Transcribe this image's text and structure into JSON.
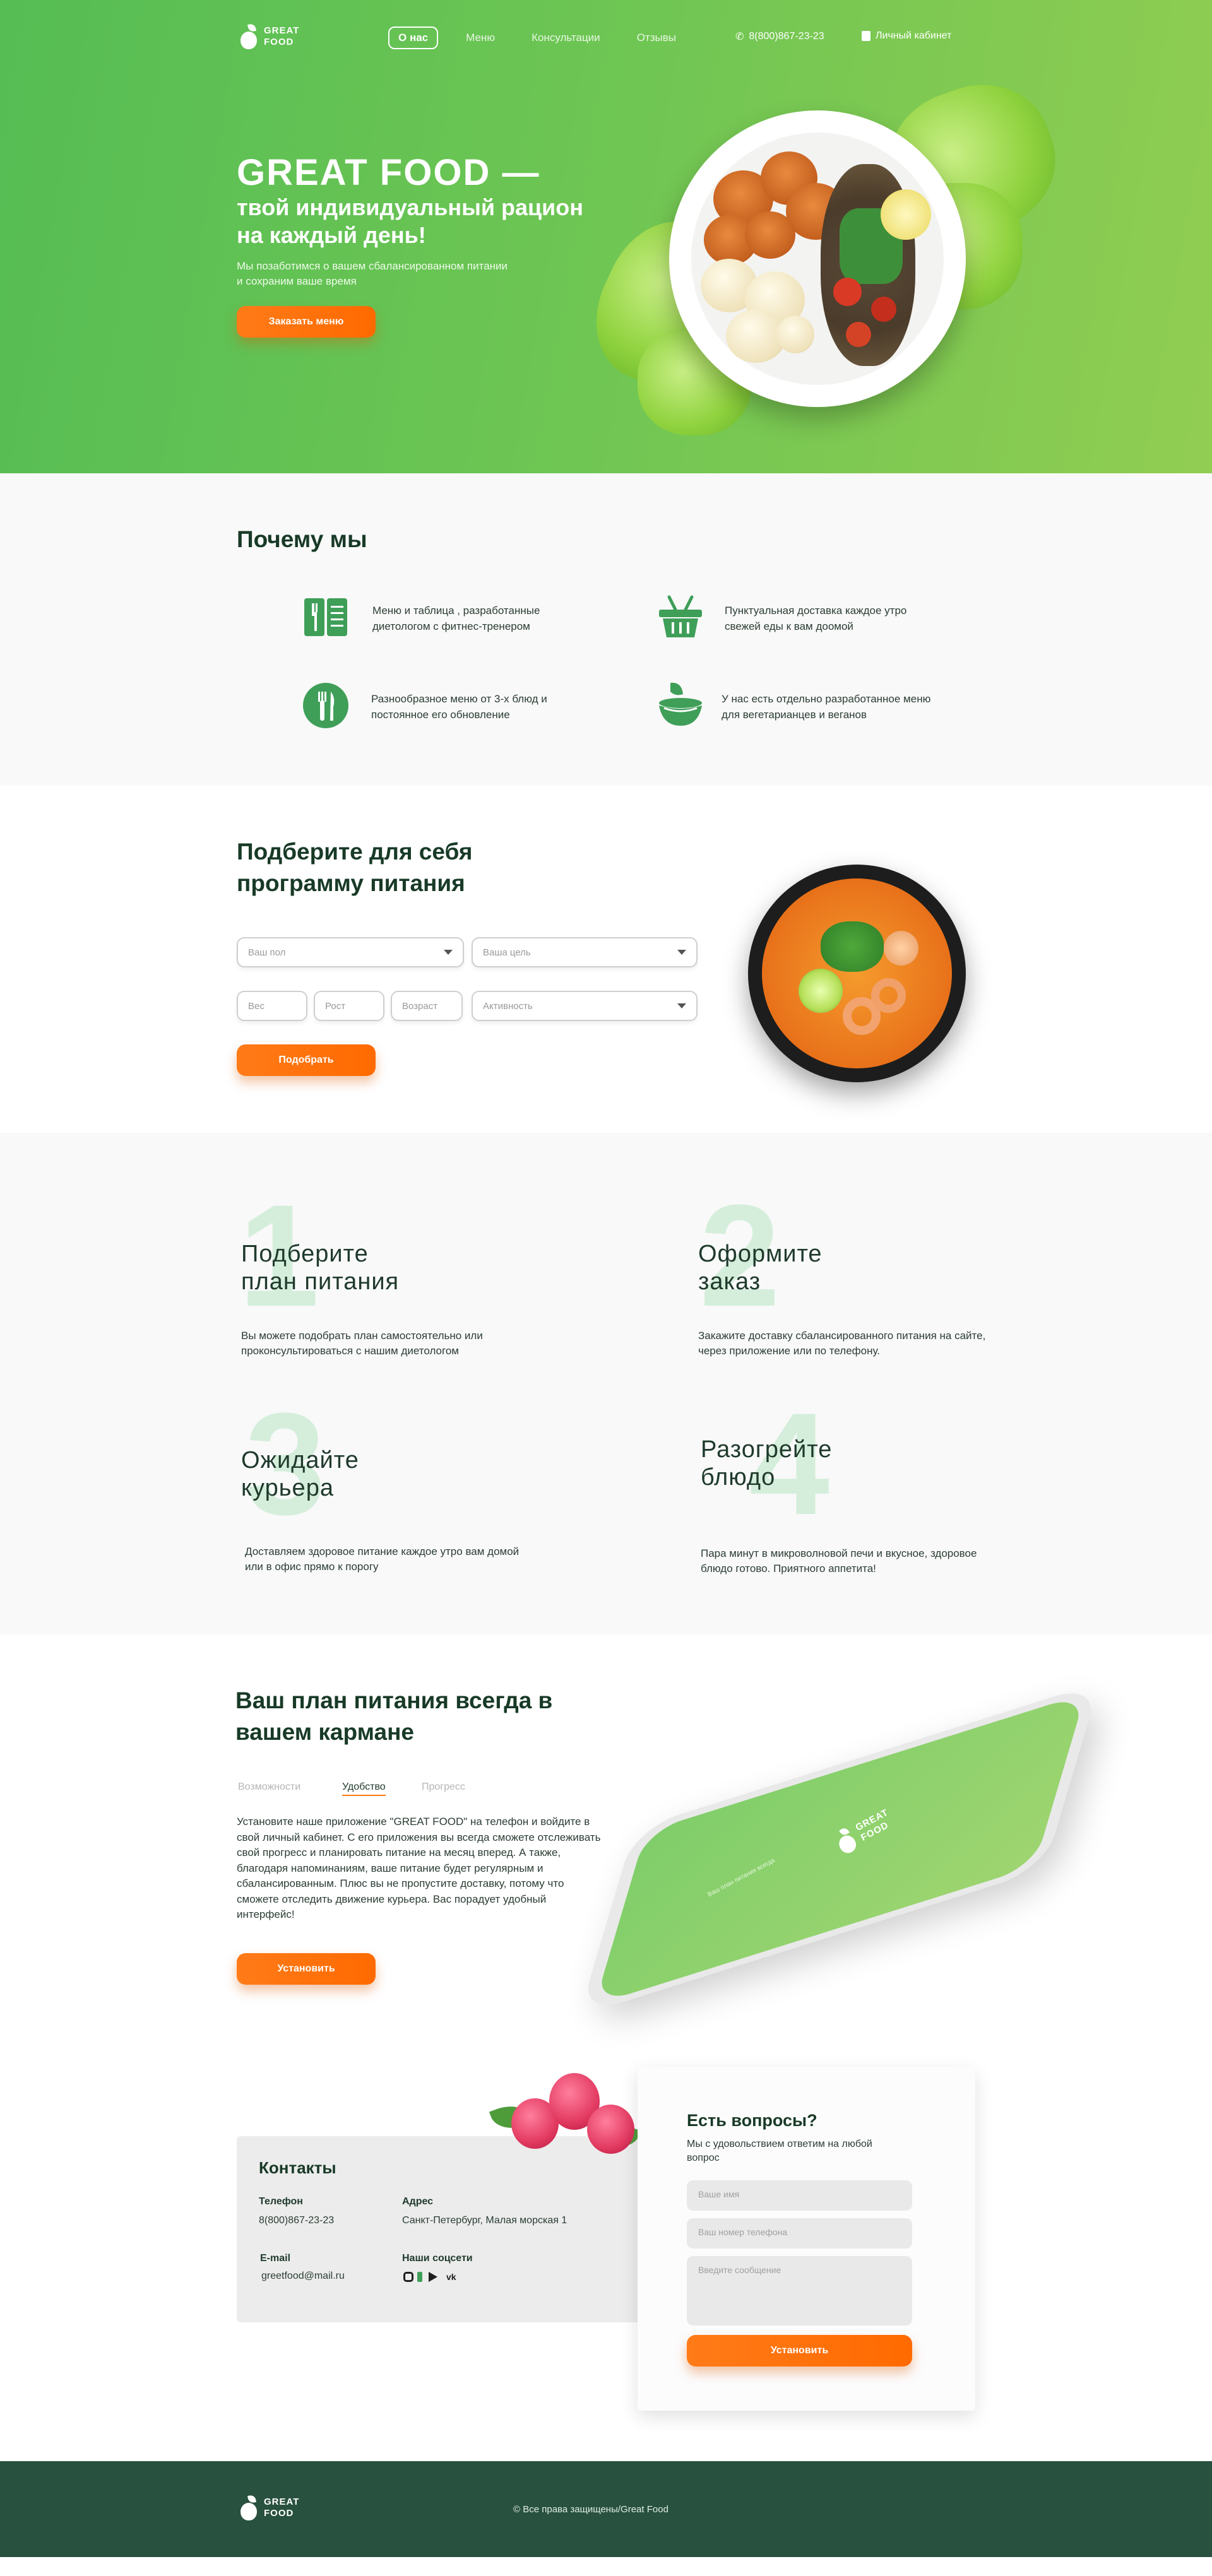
{
  "header": {
    "logo_line1": "GREAT",
    "logo_line2": "FOOD",
    "nav": [
      {
        "label": "О нас",
        "active": true
      },
      {
        "label": "Меню",
        "active": false
      },
      {
        "label": "Консультации",
        "active": false
      },
      {
        "label": "Отзывы",
        "active": false
      }
    ],
    "phone": "8(800)867-23-23",
    "cabinet": "Личный кабинет"
  },
  "hero": {
    "title": "GREAT FOOD —",
    "subtitle": "твой индивидуальный рацион на каждый день!",
    "description": "Мы позаботимся о вашем сбалансированном питании и сохраним ваше  время",
    "button": "Заказать меню"
  },
  "why": {
    "title": "Почему мы",
    "features": [
      {
        "icon": "menu-book-icon",
        "text": "Меню и таблица , разработанные диетологом с фитнес-тренером"
      },
      {
        "icon": "basket-icon",
        "text": "Пунктуальная доставка каждое утро свежей еды к вам доомой"
      },
      {
        "icon": "fork-knife-icon",
        "text": "Разнообразное меню от 3-х блюд и постоянное его обновление"
      },
      {
        "icon": "salad-bowl-icon",
        "text": "У нас есть отдельно разработанное меню для вегетарианцев и веганов"
      }
    ]
  },
  "program": {
    "title": "Подберите для себя программу питания",
    "gender_placeholder": "Ваш пол",
    "goal_placeholder": "Ваша цель",
    "weight_placeholder": "Вес",
    "height_placeholder": "Рост",
    "age_placeholder": "Возраст",
    "activity_placeholder": "Активность",
    "button": "Подобрать"
  },
  "steps": [
    {
      "num": "1",
      "title_line1": "Подберите",
      "title_line2": "план питания",
      "desc": "Вы можете подобрать план самостоятельно или проконсультироваться с нашим диетологом"
    },
    {
      "num": "2",
      "title_line1": "Оформите",
      "title_line2": "заказ",
      "desc": "Закажите доставку сбалансированного питания на сайте, через приложение или по телефону."
    },
    {
      "num": "3",
      "title_line1": "Ожидайте",
      "title_line2": "курьера",
      "desc": "Доставляем здоровое питание каждое утро вам домой или в офис прямо к порогу"
    },
    {
      "num": "4",
      "title_line1": "Разогрейте",
      "title_line2": "блюдо",
      "desc": "Пара минут в микроволновой печи и вкусное, здоровое блюдо готово. Приятного аппетита!"
    }
  ],
  "app": {
    "title": "Ваш план питания всегда в вашем кармане",
    "tabs": [
      {
        "label": "Возможности",
        "active": false
      },
      {
        "label": "Удобство",
        "active": true
      },
      {
        "label": "Прогресс",
        "active": false
      }
    ],
    "text": "Установите наше приложение \"GREAT FOOD\" на телефон и войдите в свой личный кабинет. С его приложения вы всегда сможете отслеживать свой прогресс и планировать питание на месяц вперед. А также, благодаря напоминаниям, ваше питание будет регулярным и сбалансированным. Плюс вы не пропустите доставку, потому что сможете отследить движение курьера. Вас порадует удобный интерфейс!",
    "button": "Установить",
    "phone_logo_line1": "GREAT",
    "phone_logo_line2": "FOOD",
    "phone_tagline": "Ваш план питания всегда"
  },
  "contacts": {
    "title": "Контакты",
    "phone_label": "Телефон",
    "phone_value": "8(800)867-23-23",
    "address_label": "Адрес",
    "address_value": "Санкт-Петербург, Малая морская 1",
    "email_label": "E-mail",
    "email_value": "greetfood@mail.ru",
    "social_label": "Наши соцсети",
    "socials": [
      "instagram-icon",
      "facebook-icon",
      "telegram-icon",
      "vk-icon"
    ]
  },
  "question_form": {
    "title": "Есть вопросы?",
    "subtitle": "Мы с удовольствием ответим на любой вопрос",
    "name_placeholder": "Ваше имя",
    "phone_placeholder": "Ваш номер телефона",
    "message_placeholder": "Введите сообщение",
    "button": "Установить"
  },
  "footer": {
    "logo_line1": "GREAT",
    "logo_line2": "FOOD",
    "copyright": "© Все права защищены/Great Food"
  },
  "colors": {
    "green_primary": "#55bd54",
    "green_light": "#91cd52",
    "orange_button": "#ff7416",
    "footer_bg": "#29513f",
    "section_bg": "#f9f9f9"
  }
}
